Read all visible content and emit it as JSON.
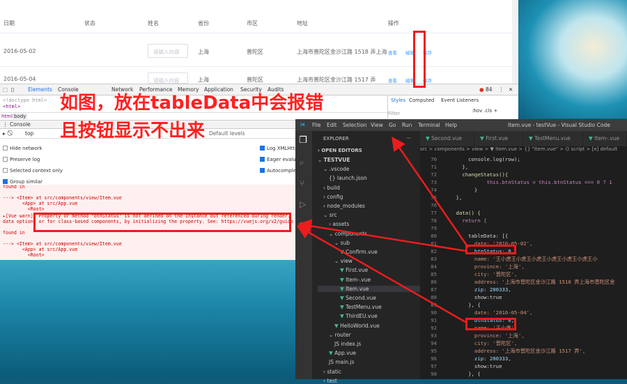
{
  "table": {
    "headers": [
      "日期",
      "状态",
      "姓名",
      "省份",
      "市区",
      "地址",
      "操作"
    ],
    "rows": [
      {
        "date": "2016-05-02",
        "placeholder": "请输入内容",
        "province": "上海",
        "city": "普陀区",
        "address": "上海市普陀区金沙江路 1518 弄上海",
        "ops": [
          "查看",
          "编辑",
          "保存"
        ]
      },
      {
        "date": "2016-05-04",
        "placeholder": "请输入内容",
        "province": "上海",
        "city": "普陀区",
        "address": "上海市普陀区金沙江路 1517 弄",
        "ops": [
          "查看",
          "编辑",
          "保存"
        ]
      }
    ]
  },
  "devtools": {
    "tabs": [
      "Elements",
      "Console",
      "Network",
      "Performance",
      "Memory",
      "Application",
      "Security",
      "Audits"
    ],
    "error_count": "84",
    "elements_lines": [
      "<!doctype html>",
      "<html>"
    ],
    "breadcrumb": [
      "html",
      "body"
    ],
    "styles_tabs": [
      "Styles",
      "Computed",
      "Event Listeners"
    ],
    "filter_placeholder": "Filter",
    "filter_right": ":hov .cls +",
    "console_tab": "Console",
    "context": "top",
    "levels": "Default levels",
    "options_left": [
      "Hide network",
      "Preserve log",
      "Selected context only",
      "Group similar"
    ],
    "options_right": [
      "Log XMLHttp",
      "Eager evalua",
      "Autocomple"
    ],
    "log_lines": [
      "found in",
      "",
      "---> <Item> at src/components/view/Item.vue",
      "       <App> at src/App.vue",
      "         <Root>",
      "▸[Vue warn]: Property or method \"btnStatus\" is not defined on the instance but referenced during render.",
      "data option, or for class-based components, by initializing the property. See: https://vuejs.org/v2/guide",
      "",
      "found in",
      "",
      "---> <Item> at src/components/view/Item.vue",
      "       <App> at src/App.vue",
      "         <Root>"
    ]
  },
  "annotation": {
    "line1": "如图，放在tableData中会报错",
    "line2": "且按钮显示不出来"
  },
  "vscode": {
    "menu": [
      "File",
      "Edit",
      "Selection",
      "View",
      "Go",
      "Run",
      "Terminal",
      "Help"
    ],
    "title": "Item.vue - testVue - Visual Studio Code",
    "explorer": "EXPLORER",
    "explorer_more": "···",
    "open_editors": "OPEN EDITORS",
    "tree": [
      {
        "label": "TESTVUE",
        "depth": 0,
        "kind": "root"
      },
      {
        "label": ".vscode",
        "depth": 1,
        "kind": "folder-open"
      },
      {
        "label": "{} launch.json",
        "depth": 2,
        "kind": "file"
      },
      {
        "label": "build",
        "depth": 1,
        "kind": "folder"
      },
      {
        "label": "config",
        "depth": 1,
        "kind": "folder"
      },
      {
        "label": "node_modules",
        "depth": 1,
        "kind": "folder"
      },
      {
        "label": "src",
        "depth": 1,
        "kind": "folder-open"
      },
      {
        "label": "assets",
        "depth": 2,
        "kind": "folder"
      },
      {
        "label": "components",
        "depth": 2,
        "kind": "folder-open"
      },
      {
        "label": "sub",
        "depth": 3,
        "kind": "folder-open"
      },
      {
        "label": "Confirm.vue",
        "depth": 4,
        "kind": "vue"
      },
      {
        "label": "view",
        "depth": 3,
        "kind": "folder-open"
      },
      {
        "label": "First.vue",
        "depth": 4,
        "kind": "vue"
      },
      {
        "label": "Item-.vue",
        "depth": 4,
        "kind": "vue"
      },
      {
        "label": "Item.vue",
        "depth": 4,
        "kind": "vue-active"
      },
      {
        "label": "Second.vue",
        "depth": 4,
        "kind": "vue"
      },
      {
        "label": "TestMenu.vue",
        "depth": 4,
        "kind": "vue"
      },
      {
        "label": "ThirdEU.vue",
        "depth": 4,
        "kind": "vue"
      },
      {
        "label": "HelloWorld.vue",
        "depth": 3,
        "kind": "vue"
      },
      {
        "label": "router",
        "depth": 2,
        "kind": "folder-open"
      },
      {
        "label": "JS index.js",
        "depth": 3,
        "kind": "file"
      },
      {
        "label": "App.vue",
        "depth": 2,
        "kind": "vue"
      },
      {
        "label": "JS main.js",
        "depth": 2,
        "kind": "file"
      },
      {
        "label": "static",
        "depth": 1,
        "kind": "folder"
      },
      {
        "label": "test",
        "depth": 1,
        "kind": "folder"
      }
    ],
    "tabs": [
      "Second.vue",
      "First.vue",
      "TestMenu.vue",
      "Item-.vue"
    ],
    "breadcrumb": "src > components > view > ▼ Item.vue > {} \"Item.vue\" > ⌬ script > [e] default",
    "code": [
      {
        "n": "70",
        "t": "        console.log(row);"
      },
      {
        "n": "71",
        "t": "      },"
      },
      {
        "n": "72",
        "t": "      changeStatus(){"
      },
      {
        "n": "73",
        "t": "              this.btnStatus = this.btnStatus === 0 ? 1"
      },
      {
        "n": "74",
        "t": "          }"
      },
      {
        "n": "75",
        "t": "    },"
      },
      {
        "n": "76",
        "t": ""
      },
      {
        "n": "77",
        "t": "    data() {"
      },
      {
        "n": "78",
        "t": "      return {"
      },
      {
        "n": "79",
        "t": ""
      },
      {
        "n": "80",
        "t": "        tableData: [{"
      },
      {
        "n": "81",
        "t": "          date: '2016-05-02',"
      },
      {
        "n": "82",
        "t": "          btnStatus: 0,"
      },
      {
        "n": "83",
        "t": "          name: '王小虎王小虎王小虎王小虎王小虎王小虎王小"
      },
      {
        "n": "84",
        "t": "          province: '上海',"
      },
      {
        "n": "85",
        "t": "          city: '普陀区',"
      },
      {
        "n": "86",
        "t": "          address: '上海市普陀区金沙江路 1518 弄上海市普陀区金"
      },
      {
        "n": "87",
        "t": "          zip: 200333,"
      },
      {
        "n": "88",
        "t": "          show:true"
      },
      {
        "n": "89",
        "t": "        }, {"
      },
      {
        "n": "90",
        "t": "          date: '2016-05-04',"
      },
      {
        "n": "91",
        "t": "          btnStatus: 0,"
      },
      {
        "n": "92",
        "t": "          name: '王小虎',"
      },
      {
        "n": "93",
        "t": "          province: '上海',"
      },
      {
        "n": "94",
        "t": "          city: '普陀区',"
      },
      {
        "n": "95",
        "t": "          address: '上海市普陀区金沙江路 1517 弄',"
      },
      {
        "n": "96",
        "t": "          zip: 200333,"
      },
      {
        "n": "97",
        "t": "          show:true"
      },
      {
        "n": "98",
        "t": "        }, {"
      }
    ]
  },
  "colors": {
    "annotation": "#ff2020",
    "link": "#409eff",
    "vue": "#41b883"
  }
}
